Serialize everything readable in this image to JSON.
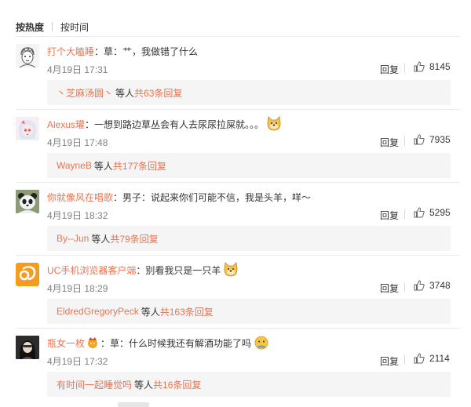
{
  "sort": {
    "hot_label": "按热度",
    "time_label": "按时间"
  },
  "comments": [
    {
      "user": "打个大瞌睡",
      "text": "：草：艹，我做错了什么",
      "time": "4月19日 17:31",
      "reply_label": "回复",
      "likes": "8145",
      "sub": {
        "name": "丶芝麻汤圆丶",
        "others": "等人",
        "count_text": "共63条回复"
      }
    },
    {
      "user": "Alexus瓘",
      "text": "：一想到路边草丛会有人去尿尿拉屎就。。。",
      "time": "4月19日 17:48",
      "reply_label": "回复",
      "likes": "7935",
      "sub": {
        "name": "WayneB",
        "others": "等人",
        "count_text": "共177条回复"
      }
    },
    {
      "user": "你就像风在唱歌",
      "text": "：男子：说起来你们可能不信，我是头羊，咩～",
      "time": "4月19日 18:32",
      "reply_label": "回复",
      "likes": "5295",
      "sub": {
        "name": "By--Jun",
        "others": "等人",
        "count_text": "共79条回复"
      }
    },
    {
      "user": "UC手机浏览器客户端",
      "text": "：别看我只是一只羊",
      "time": "4月19日 18:29",
      "reply_label": "回复",
      "likes": "3748",
      "sub": {
        "name": "EldredGregoryPeck",
        "others": "等人",
        "count_text": "共163条回复"
      }
    },
    {
      "user": "瓶女一枚",
      "text": "：草：什么时候我还有解酒功能了吗",
      "time": "4月19日 17:32",
      "reply_label": "回复",
      "likes": "2114",
      "sub": {
        "name": "有时间一起睡觉吗",
        "others": "等人",
        "count_text": "共16条回复"
      }
    }
  ],
  "colors": {
    "username": "#eb7350",
    "subbox_bg": "#f5f5f5",
    "meta": "#808080"
  }
}
